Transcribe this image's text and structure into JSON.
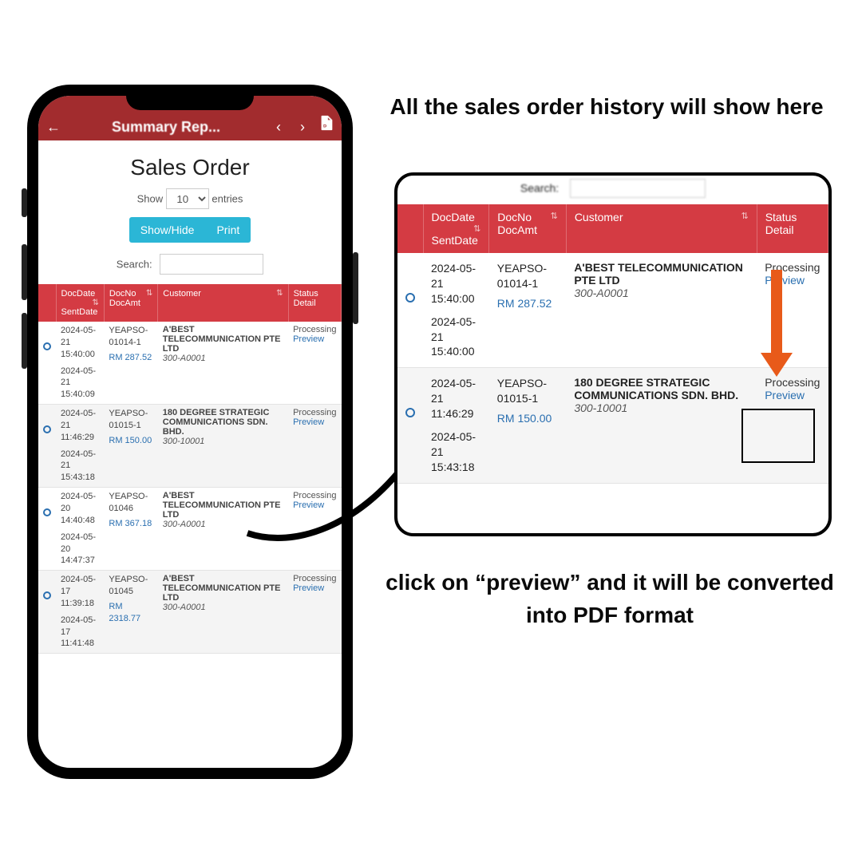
{
  "annotations": {
    "top": "All the  sales order history will show here",
    "bottom": "click on “preview” and it will be converted into PDF format"
  },
  "phone": {
    "header_title": "Summary Rep...",
    "page_title": "Sales Order",
    "show_label": "Show",
    "entries_label": "entries",
    "entries_value": "10",
    "show_hide_label": "Show/Hide",
    "print_label": "Print",
    "search_label": "Search:",
    "search_value": "",
    "columns": {
      "c1a": "DocDate",
      "c1b": "SentDate",
      "c2a": "DocNo",
      "c2b": "DocAmt",
      "c3": "Customer",
      "c4a": "Status",
      "c4b": "Detail"
    },
    "rows": [
      {
        "doc_date": "2024-05-21",
        "doc_time": "15:40:00",
        "sent_date": "2024-05-21",
        "sent_time": "15:40:09",
        "doc_no": "YEAPSO-01014-1",
        "doc_amt": "RM 287.52",
        "customer": "A'BEST TELECOMMUNICATION PTE LTD",
        "cust_code": "300-A0001",
        "status": "Processing",
        "detail": "Preview"
      },
      {
        "doc_date": "2024-05-21",
        "doc_time": "11:46:29",
        "sent_date": "2024-05-21",
        "sent_time": "15:43:18",
        "doc_no": "YEAPSO-01015-1",
        "doc_amt": "RM 150.00",
        "customer": "180 DEGREE STRATEGIC COMMUNICATIONS SDN. BHD.",
        "cust_code": "300-10001",
        "status": "Processing",
        "detail": "Preview"
      },
      {
        "doc_date": "2024-05-20",
        "doc_time": "14:40:48",
        "sent_date": "2024-05-20",
        "sent_time": "14:47:37",
        "doc_no": "YEAPSO-01046",
        "doc_amt": "RM 367.18",
        "customer": "A'BEST TELECOMMUNICATION PTE LTD",
        "cust_code": "300-A0001",
        "status": "Processing",
        "detail": "Preview"
      },
      {
        "doc_date": "2024-05-17",
        "doc_time": "11:39:18",
        "sent_date": "2024-05-17",
        "sent_time": "11:41:48",
        "doc_no": "YEAPSO-01045",
        "doc_amt": "RM 2318.77",
        "customer": "A'BEST TELECOMMUNICATION PTE LTD",
        "cust_code": "300-A0001",
        "status": "Processing",
        "detail": "Preview"
      }
    ]
  },
  "zoom": {
    "search_label": "Search:",
    "search_value": "",
    "columns": {
      "c1a": "DocDate",
      "c1b": "SentDate",
      "c2a": "DocNo",
      "c2b": "DocAmt",
      "c3": "Customer",
      "c4a": "Status",
      "c4b": "Detail"
    },
    "rows": [
      {
        "doc_date": "2024-05-21",
        "doc_time": "15:40:00",
        "sent_date": "2024-05-21",
        "sent_time": "15:40:00",
        "doc_no": "YEAPSO-01014-1",
        "doc_amt": "RM 287.52",
        "customer": "A'BEST TELECOMMUNICATION PTE LTD",
        "cust_code": "300-A0001",
        "status": "Processing",
        "detail": "Preview"
      },
      {
        "doc_date": "2024-05-21",
        "doc_time": "11:46:29",
        "sent_date": "2024-05-21",
        "sent_time": "15:43:18",
        "doc_no": "YEAPSO-01015-1",
        "doc_amt": "RM 150.00",
        "customer": "180 DEGREE STRATEGIC COMMUNICATIONS SDN. BHD.",
        "cust_code": "300-10001",
        "status": "Processing",
        "detail": "Preview"
      }
    ]
  }
}
